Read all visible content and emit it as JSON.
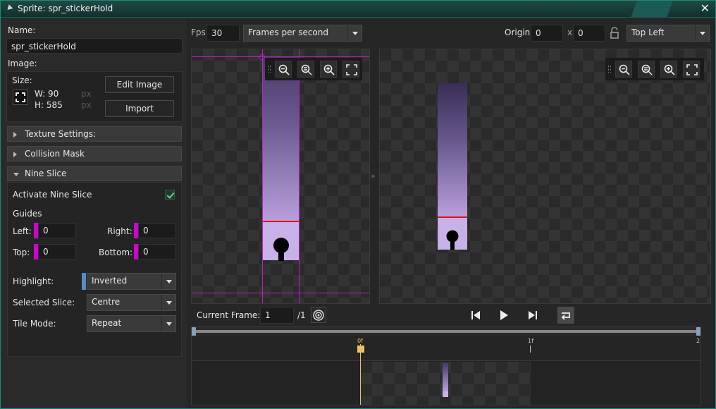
{
  "window": {
    "title": "Sprite: spr_stickerHold",
    "close_glyph": "✕"
  },
  "left": {
    "name_label": "Name:",
    "name_value": "spr_stickerHold",
    "image_label": "Image:",
    "size_label": "Size:",
    "width_text": "W: 90",
    "height_text": "H: 585",
    "px_unit": "px",
    "edit_image_label": "Edit Image",
    "import_label": "Import",
    "sections": {
      "texture": "Texture Settings:",
      "collision": "Collision Mask",
      "nine_slice": "Nine Slice"
    },
    "nine": {
      "activate_label": "Activate Nine Slice",
      "activate_checked": true,
      "guides_label": "Guides",
      "left_label": "Left:",
      "left_value": "0",
      "right_label": "Right:",
      "right_value": "0",
      "top_label": "Top:",
      "top_value": "0",
      "bottom_label": "Bottom:",
      "bottom_value": "0",
      "highlight_label": "Highlight:",
      "highlight_value": "Inverted",
      "selected_slice_label": "Selected Slice:",
      "selected_slice_value": "Centre",
      "tile_mode_label": "Tile Mode:",
      "tile_mode_value": "Repeat",
      "guide_color": "#d000d0"
    }
  },
  "toolbar": {
    "fps_label": "Fps",
    "fps_value": "30",
    "fps_mode": "Frames per second",
    "origin_label": "Origin",
    "origin_x": "0",
    "origin_sep": "x",
    "origin_y": "0",
    "origin_preset": "Top Left"
  },
  "playback": {
    "current_frame_label": "Current Frame:",
    "current_frame_value": "1",
    "total_frames": "/1"
  },
  "timeline": {
    "marker_0": "0f",
    "marker_1": "1f",
    "marker_2": "2"
  },
  "icons": [
    "expand-icon",
    "zoom-out-icon",
    "zoom-reset-icon",
    "zoom-in-icon",
    "fit-screen-icon",
    "lock-icon",
    "onion-skin-icon",
    "skip-start-icon",
    "play-icon",
    "skip-end-icon",
    "loop-icon"
  ]
}
